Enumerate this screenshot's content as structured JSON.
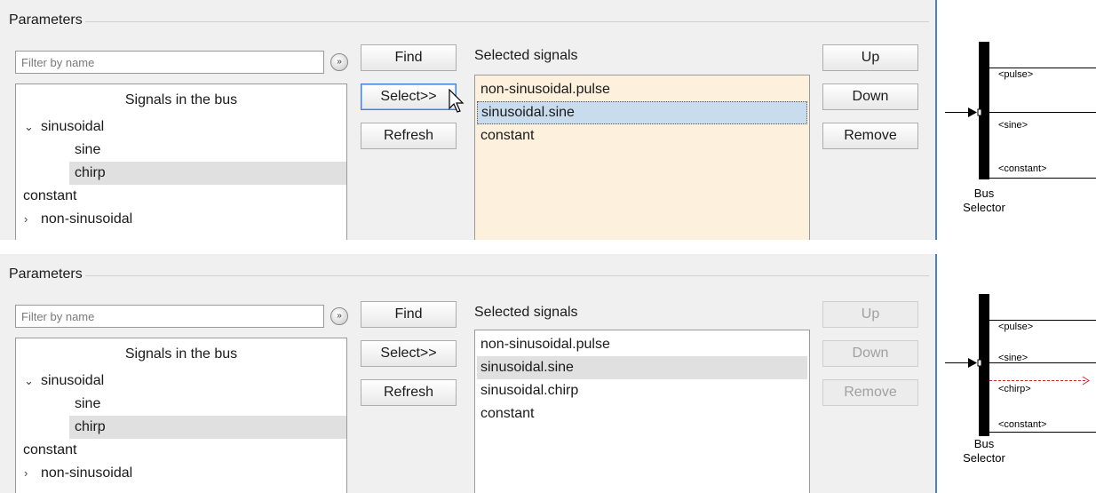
{
  "top": {
    "group_title": "Parameters",
    "filter_placeholder": "Filter by name",
    "filter_icon": "chevron-double-down-icon",
    "tree": {
      "header": "Signals in the bus",
      "items": [
        {
          "label": "sinusoidal",
          "expanded": true,
          "level": 0,
          "caret": "⌄"
        },
        {
          "label": "sine",
          "level": 1
        },
        {
          "label": "chirp",
          "level": 1,
          "selected": true
        },
        {
          "label": "constant",
          "level": 0
        },
        {
          "label": "non-sinusoidal",
          "level": 0,
          "caret": "›"
        }
      ]
    },
    "buttons": {
      "find": "Find",
      "select": "Select>>",
      "refresh": "Refresh"
    },
    "selected_title": "Selected signals",
    "selected": [
      "non-sinusoidal.pulse",
      "sinusoidal.sine",
      "constant"
    ],
    "right_buttons": {
      "up": "Up",
      "down": "Down",
      "remove": "Remove"
    },
    "diagram": {
      "ports": [
        "<pulse>",
        "<sine>",
        "<constant>"
      ],
      "caption": [
        "Bus",
        "Selector"
      ]
    }
  },
  "bottom": {
    "group_title": "Parameters",
    "filter_placeholder": "Filter by name",
    "filter_icon": "chevron-double-down-icon",
    "tree": {
      "header": "Signals in the bus",
      "items": [
        {
          "label": "sinusoidal",
          "expanded": true,
          "level": 0,
          "caret": "⌄"
        },
        {
          "label": "sine",
          "level": 1
        },
        {
          "label": "chirp",
          "level": 1,
          "selected": true
        },
        {
          "label": "constant",
          "level": 0
        },
        {
          "label": "non-sinusoidal",
          "level": 0,
          "caret": "›"
        }
      ]
    },
    "buttons": {
      "find": "Find",
      "select": "Select>>",
      "refresh": "Refresh"
    },
    "selected_title": "Selected signals",
    "selected": [
      "non-sinusoidal.pulse",
      "sinusoidal.sine",
      "sinusoidal.chirp",
      "constant"
    ],
    "right_buttons": {
      "up": "Up",
      "down": "Down",
      "remove": "Remove"
    },
    "diagram": {
      "ports": [
        "<pulse>",
        "<sine>",
        "<chirp>",
        "<constant>"
      ],
      "caption": [
        "Bus",
        "Selector"
      ]
    }
  },
  "colors": {
    "selected_list_bg_top": "#fdf0dc",
    "focus_highlight": "#c9dced",
    "new_signal_line": "#e02020"
  }
}
